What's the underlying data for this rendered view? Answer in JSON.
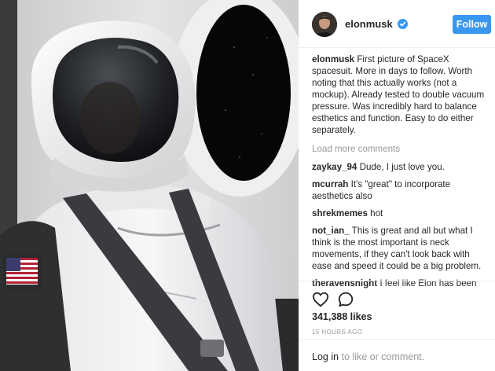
{
  "post": {
    "username": "elonmusk",
    "follow_label": "Follow",
    "caption_user": "elonmusk",
    "caption_text": " First picture of SpaceX spacesuit. More in days to follow. Worth noting that this actually works (not a mockup). Already tested to double vacuum pressure. Was incredibly hard to balance esthetics and function. Easy to do either separately.",
    "load_more": "Load more comments",
    "comments": [
      {
        "user": "zaykay_94",
        "text": " Dude, I just love you."
      },
      {
        "user": "mcurrah",
        "text": " It's \"great\" to incorporate aesthetics also"
      },
      {
        "user": "shrekmemes",
        "text": " hot"
      },
      {
        "user": "not_ian_",
        "text": " This is great and all but what I think is the most important is neck movements, if they can't look back with ease and speed it could be a big problem."
      },
      {
        "user": "theravensnight",
        "text": " I feel like Elon has been"
      }
    ],
    "likes": "341,388 likes",
    "time": "15 HOURS AGO",
    "login_link": "Log in",
    "login_suffix": " to like or comment."
  },
  "icons": {
    "verified": "verified-badge-icon",
    "like": "heart-icon",
    "comment": "comment-bubble-icon"
  },
  "colors": {
    "follow_button": "#3897f0",
    "verified_badge": "#3897f0",
    "muted_text": "#999999",
    "text": "#262626"
  }
}
